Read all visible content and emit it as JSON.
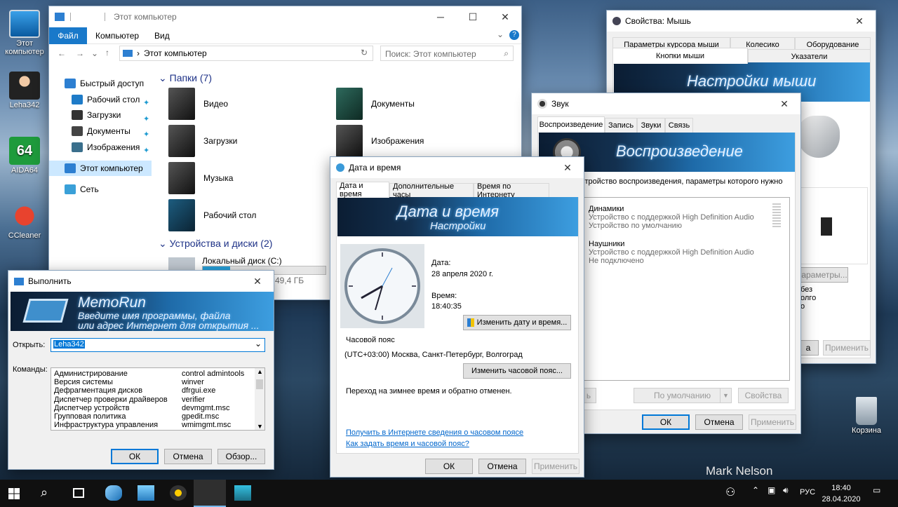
{
  "desktop": {
    "icons": [
      {
        "label": "Этот компьютер"
      },
      {
        "label": "Leha342"
      },
      {
        "label": "AIDA64"
      },
      {
        "label": "CCleaner"
      },
      {
        "label": "Корзина"
      }
    ],
    "watermark": "Mark Nelson",
    "accent_color": "#0078d7"
  },
  "explorer": {
    "title": "Этот компьютер",
    "ribbon_tabs": [
      "Файл",
      "Компьютер",
      "Вид"
    ],
    "address": "Этот компьютер",
    "search_placeholder": "Поиск: Этот компьютер",
    "nav": {
      "quick_access": "Быстрый доступ",
      "quick_items": [
        "Рабочий стол",
        "Загрузки",
        "Документы",
        "Изображения"
      ],
      "this_pc": "Этот компьютер",
      "network": "Сеть"
    },
    "folders_header": "Папки (7)",
    "folders": [
      "Видео",
      "Документы",
      "Загрузки",
      "Изображения",
      "Музыка",
      "Рабочий стол"
    ],
    "devices_header": "Устройства и диски (2)",
    "disk": {
      "name": "Локальный диск (C:)",
      "free": "49,4 ГБ",
      "used_fraction": 0.22
    }
  },
  "mouse": {
    "title": "Свойства: Мышь",
    "tabs_row1": [
      "Параметры курсора мыши",
      "Колесико",
      "Оборудование"
    ],
    "tabs_row2": [
      "Кнопки мыши",
      "Указатели"
    ],
    "banner": "Настройки мыши",
    "params_btn": "араметры...",
    "fragments": [
      "без",
      "олго",
      "о"
    ],
    "fragment_a": "а",
    "apply": "Применить"
  },
  "sound": {
    "title": "Звук",
    "tabs": [
      "Воспроизведение",
      "Запись",
      "Звуки",
      "Связь"
    ],
    "banner": "Воспроизведение",
    "hint": "стройство воспроизведения, параметры которого нужно",
    "devices": [
      {
        "name": "Динамики",
        "desc": "Устройство с поддержкой High Definition Audio",
        "status": "Устройство по умолчанию"
      },
      {
        "name": "Наушники",
        "desc": "Устройство с поддержкой High Definition Audio",
        "status": "Не подключено"
      }
    ],
    "left_btn_fragment": "ь",
    "default_btn": "По умолчанию",
    "props_btn": "Свойства",
    "ok": "ОК",
    "cancel": "Отмена",
    "apply": "Применить"
  },
  "datetime": {
    "title": "Дата и время",
    "tabs": [
      "Дата и время",
      "Дополнительные часы",
      "Время по Интернету"
    ],
    "banner_title": "Дата и время",
    "banner_sub": "Настройки",
    "date_label": "Дата:",
    "date_value": "28 апреля 2020 г.",
    "time_label": "Время:",
    "time_value": "18:40:35",
    "change_dt": "Изменить дату и время...",
    "tz_label": "Часовой пояс",
    "tz_value": "(UTC+03:00) Москва, Санкт-Петербург, Волгоград",
    "change_tz": "Изменить часовой пояс...",
    "dst_note": "Переход на зимнее время и обратно отменен.",
    "link1": "Получить в Интернете сведения о часовом поясе",
    "link2": "Как задать время и часовой пояс?",
    "ok": "ОК",
    "cancel": "Отмена",
    "apply": "Применить"
  },
  "run": {
    "title": "Выполнить",
    "banner_title": "MemoRun",
    "banner_line1": "Введите имя программы, файла",
    "banner_line2": "или адрес Интернет для открытия ...",
    "open_label": "Открыть:",
    "open_value": "Leha342",
    "commands_label": "Команды:",
    "commands": [
      {
        "name": "Администрирование",
        "cmd": "control admintools"
      },
      {
        "name": "Версия системы",
        "cmd": "winver"
      },
      {
        "name": "Дефрагментация дисков",
        "cmd": "dfrgui.exe"
      },
      {
        "name": "Диспетчер проверки драйверов",
        "cmd": "verifier"
      },
      {
        "name": "Диспетчер устройств",
        "cmd": "devmgmt.msc"
      },
      {
        "name": "Групповая политика",
        "cmd": "gpedit.msc"
      },
      {
        "name": "Инфраструктура управления",
        "cmd": "wmimgmt.msc"
      }
    ],
    "ok": "ОК",
    "cancel": "Отмена",
    "browse": "Обзор..."
  },
  "taskbar": {
    "lang": "РУС",
    "time": "18:40",
    "date": "28.04.2020"
  }
}
